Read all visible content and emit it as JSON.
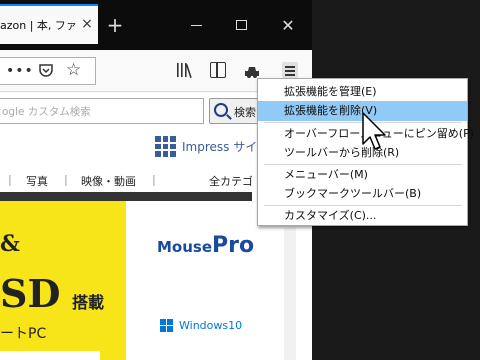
{
  "browser": {
    "tab_title": "azon | 本, ファ",
    "tab_close": "×",
    "new_tab": "+",
    "close": "✕",
    "url_dots": "•••",
    "star": "☆"
  },
  "page": {
    "search_placeholder": "ogle カスタム検索",
    "search_button": "検索",
    "impress_label": "Impress サイ",
    "categories": [
      "|",
      "写真",
      "|",
      "映像・動画",
      "|",
      "全カテゴ"
    ],
    "banner_line1": "&",
    "banner_line2": "SD",
    "banner_line2b": "搭載",
    "banner_line3": "ートPC",
    "mousepro_1": "Mouse",
    "mousepro_2": "Pro",
    "windows10": "Windows10"
  },
  "menu": {
    "items": [
      "拡張機能を管理(E)",
      "拡張機能を削除(V)",
      "オーバーフローメニューにピン留め(P)",
      "ツールバーから削除(R)",
      "メニューバー(M)",
      "ブックマークツールバー(B)",
      "カスタマイズ(C)..."
    ],
    "highlighted_index": 1
  },
  "colors": {
    "accent": "#0a84ff",
    "menu_highlight": "#91c9f7",
    "banner": "#f7e51a"
  }
}
